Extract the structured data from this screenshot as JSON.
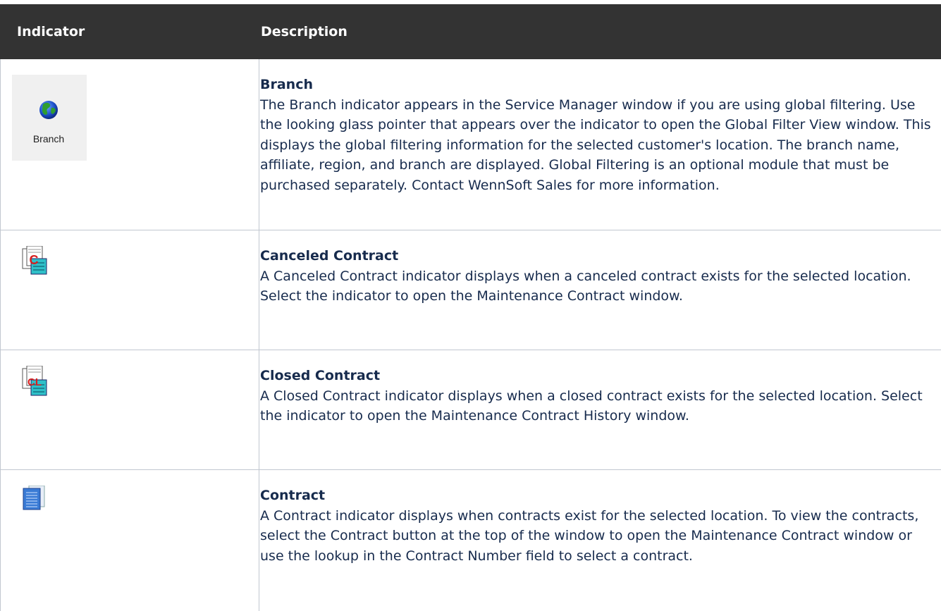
{
  "header": {
    "col_indicator": "Indicator",
    "col_description": "Description"
  },
  "rows": [
    {
      "title": "Branch",
      "desc": "The Branch indicator appears in the Service Manager window if you are using global filtering. Use the looking glass pointer that appears over the indicator to open the Global Filter View window. This displays the global filtering information for the selected customer's location. The branch name, affiliate, region, and branch are displayed. Global Filtering is an optional module that must be purchased separately. Contact WennSoft Sales for more information.",
      "icon_label": "Branch",
      "icon": "globe-icon"
    },
    {
      "title": "Canceled Contract",
      "desc": "A Canceled Contract indicator displays when a canceled contract exists for the selected location. Select the indicator to open the Maintenance Contract window.",
      "icon": "canceled-contract-icon",
      "icon_letter": "C"
    },
    {
      "title": "Closed Contract",
      "desc": "A Closed Contract indicator displays when a closed contract exists for the selected location. Select the indicator to open the Maintenance Contract History window.",
      "icon": "closed-contract-icon",
      "icon_letter": "CL"
    },
    {
      "title": "Contract",
      "desc": "A Contract indicator displays when contracts exist for the selected location. To view the contracts, select the Contract button at the top of the window to open the Maintenance Contract window or use the lookup in the Contract Number field to select a contract.",
      "icon": "contract-icon"
    }
  ],
  "colors": {
    "header_bg": "#333333",
    "border": "#c1c7d0",
    "text": "#172b4d"
  }
}
